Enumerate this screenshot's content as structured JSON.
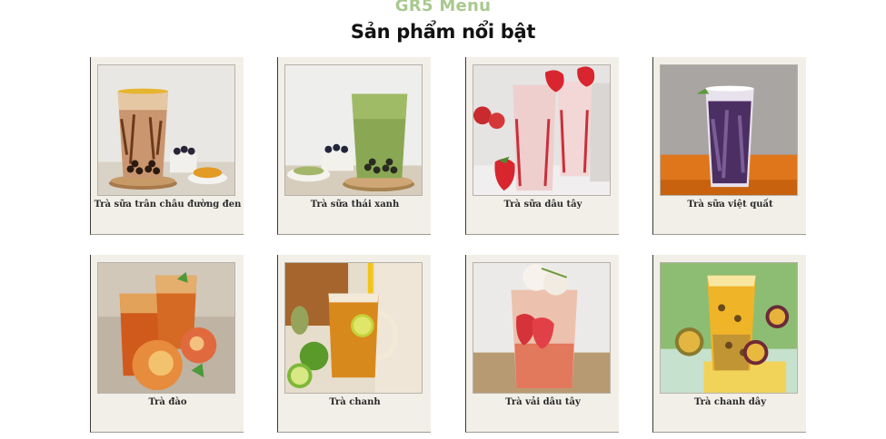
{
  "header": {
    "brand": "GR5 Menu",
    "title": "Sản phẩm nổi bật"
  },
  "products": [
    {
      "name": "Trà sữa trân châu đường đen",
      "image": "brown-sugar-boba-tea-photo"
    },
    {
      "name": "Trà sữa thái xanh",
      "image": "green-thai-milk-tea-photo"
    },
    {
      "name": "Trà sữa dâu tây",
      "image": "strawberry-milk-tea-photo"
    },
    {
      "name": "Trà sữa việt quất",
      "image": "blueberry-milk-tea-photo"
    },
    {
      "name": "Trà đào",
      "image": "peach-tea-photo"
    },
    {
      "name": "Trà chanh",
      "image": "lemon-tea-photo"
    },
    {
      "name": "Trà vải dâu tây",
      "image": "lychee-strawberry-tea-photo"
    },
    {
      "name": "Trà chanh dây",
      "image": "passion-fruit-tea-photo"
    }
  ]
}
